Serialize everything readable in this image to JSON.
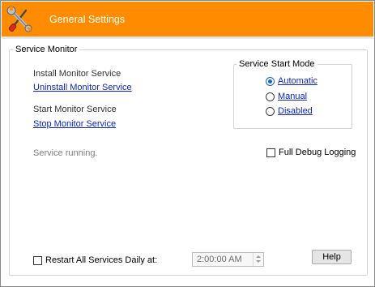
{
  "header": {
    "title": "General Settings",
    "background_color": "#ff8c00",
    "icon": "wrench-screwdriver-icon"
  },
  "service_monitor": {
    "group_title": "Service Monitor",
    "install_label": "Install Monitor Service",
    "uninstall_link": "Uninstall Monitor Service",
    "start_label": "Start Monitor Service",
    "stop_link": "Stop Monitor Service",
    "status_text": "Service running."
  },
  "start_mode": {
    "group_title": "Service Start Mode",
    "options": [
      {
        "label": "Automatic",
        "checked": true
      },
      {
        "label": "Manual",
        "checked": false
      },
      {
        "label": "Disabled",
        "checked": false
      }
    ]
  },
  "debug": {
    "label": "Full Debug Logging",
    "checked": false
  },
  "restart": {
    "label": "Restart All Services Daily at:",
    "checked": false,
    "time_value": "2:00:00 AM"
  },
  "help_button": {
    "label": "Help"
  }
}
